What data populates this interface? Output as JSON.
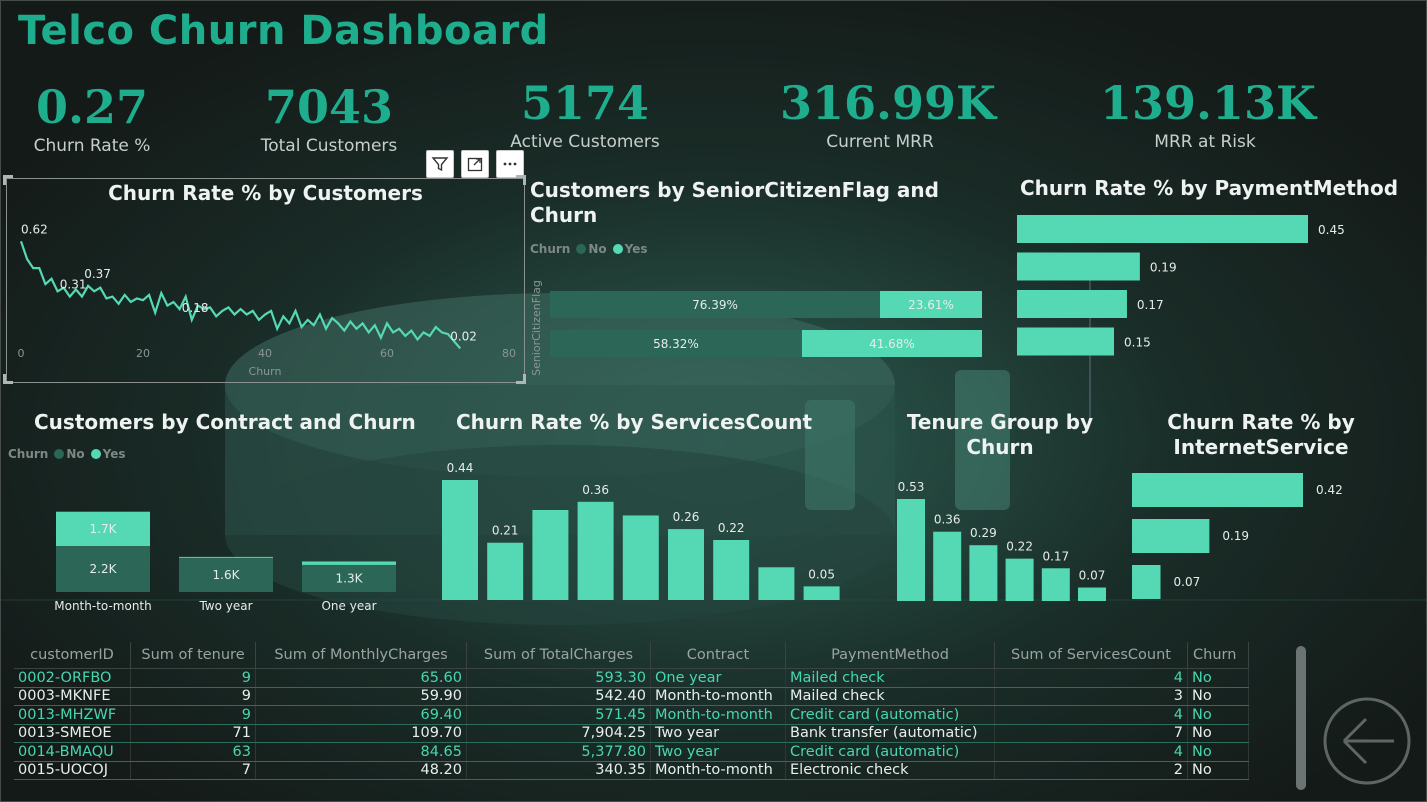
{
  "header": {
    "title": "Telco Churn Dashboard"
  },
  "kpis": [
    {
      "value": "0.27",
      "label": "Churn Rate %"
    },
    {
      "value": "7043",
      "label": "Total Customers"
    },
    {
      "value": "5174",
      "label": "Active Customers"
    },
    {
      "value": "316.99K",
      "label": "Current MRR"
    },
    {
      "value": "139.13K",
      "label": "MRR at Risk"
    }
  ],
  "visual_header": {
    "icons": [
      "filter-icon",
      "focus-mode-icon",
      "more-options-icon"
    ]
  },
  "colors": {
    "accent": "#1fae8d",
    "bar": "#55d9b4",
    "dark_bar": "#2b6657",
    "background": "#141a18"
  },
  "chart_data": [
    {
      "id": "churn_by_customers",
      "type": "line",
      "title": "Churn Rate % by Customers",
      "xlabel": "Churn",
      "xlim": [
        0,
        80
      ],
      "ylim": [
        0,
        0.7
      ],
      "x_ticks": [
        "0",
        "20",
        "40",
        "60",
        "80"
      ],
      "x": [
        0,
        1,
        2,
        3,
        4,
        5,
        6,
        7,
        8,
        9,
        10,
        11,
        12,
        13,
        14,
        15,
        16,
        17,
        18,
        19,
        20,
        21,
        22,
        23,
        24,
        25,
        26,
        27,
        28,
        29,
        30,
        31,
        32,
        33,
        34,
        35,
        36,
        37,
        38,
        39,
        40,
        41,
        42,
        43,
        44,
        45,
        46,
        47,
        48,
        49,
        50,
        51,
        52,
        53,
        54,
        55,
        56,
        57,
        58,
        59,
        60,
        61,
        62,
        63,
        64,
        65,
        66,
        67,
        68,
        69,
        70,
        71,
        72
      ],
      "y": [
        0.62,
        0.52,
        0.47,
        0.47,
        0.38,
        0.41,
        0.34,
        0.36,
        0.31,
        0.35,
        0.31,
        0.37,
        0.34,
        0.36,
        0.3,
        0.31,
        0.27,
        0.32,
        0.28,
        0.3,
        0.29,
        0.32,
        0.22,
        0.33,
        0.26,
        0.28,
        0.24,
        0.31,
        0.18,
        0.26,
        0.24,
        0.25,
        0.2,
        0.23,
        0.25,
        0.21,
        0.24,
        0.21,
        0.23,
        0.18,
        0.21,
        0.23,
        0.13,
        0.2,
        0.16,
        0.23,
        0.14,
        0.18,
        0.15,
        0.21,
        0.13,
        0.19,
        0.16,
        0.12,
        0.17,
        0.13,
        0.16,
        0.11,
        0.15,
        0.08,
        0.16,
        0.11,
        0.13,
        0.09,
        0.12,
        0.07,
        0.11,
        0.09,
        0.14,
        0.11,
        0.1,
        0.06,
        0.02
      ],
      "labels": [
        {
          "x": 0,
          "y": 0.62,
          "text": "0.62"
        },
        {
          "x": 12,
          "y": 0.37,
          "text": "0.37"
        },
        {
          "x": 8,
          "y": 0.31,
          "text": "0.31"
        },
        {
          "x": 28,
          "y": 0.18,
          "text": "0.18"
        },
        {
          "x": 72,
          "y": 0.02,
          "text": "0.02"
        }
      ]
    },
    {
      "id": "customers_by_senior",
      "type": "bar",
      "orientation": "horizontal-stacked-100",
      "title": "Customers by SeniorCitizenFlag and Churn",
      "ylabel": "SeniorCitizenFlag",
      "legend": {
        "title": "Churn",
        "items": [
          "No",
          "Yes"
        ]
      },
      "series": [
        {
          "name": "No",
          "values": [
            76.39,
            58.32
          ],
          "labels": [
            "76.39%",
            "58.32%"
          ]
        },
        {
          "name": "Yes",
          "values": [
            23.61,
            41.68
          ],
          "labels": [
            "23.61%",
            "41.68%"
          ]
        }
      ]
    },
    {
      "id": "churn_by_payment",
      "type": "bar",
      "orientation": "horizontal",
      "title": "Churn Rate % by PaymentMethod",
      "values": [
        0.45,
        0.19,
        0.17,
        0.15
      ],
      "labels": [
        "0.45",
        "0.19",
        "0.17",
        "0.15"
      ]
    },
    {
      "id": "customers_by_contract",
      "type": "bar",
      "orientation": "vertical-stacked",
      "title": "Customers by Contract and Churn",
      "legend": {
        "title": "Churn",
        "items": [
          "No",
          "Yes"
        ]
      },
      "categories": [
        "Month-to-month",
        "Two year",
        "One year"
      ],
      "series": [
        {
          "name": "No",
          "values": [
            2220,
            1647,
            1307
          ],
          "labels": [
            "2.2K",
            "1.6K",
            "1.3K"
          ]
        },
        {
          "name": "Yes",
          "values": [
            1655,
            48,
            166
          ],
          "labels": [
            "1.7K",
            "",
            ""
          ]
        }
      ]
    },
    {
      "id": "churn_by_servicescount",
      "type": "bar",
      "title": "Churn Rate % by ServicesCount",
      "values": [
        0.44,
        0.21,
        0.33,
        0.36,
        0.31,
        0.26,
        0.22,
        0.12,
        0.05
      ],
      "labels": [
        "0.44",
        "0.21",
        "",
        "0.36",
        "",
        "0.26",
        "0.22",
        "",
        "0.05"
      ]
    },
    {
      "id": "tenure_group_by_churn",
      "type": "bar",
      "title": "Tenure Group by Churn",
      "values": [
        0.53,
        0.36,
        0.29,
        0.22,
        0.17,
        0.07
      ],
      "labels": [
        "0.53",
        "0.36",
        "0.29",
        "0.22",
        "0.17",
        "0.07"
      ]
    },
    {
      "id": "churn_by_internetservice",
      "type": "bar",
      "orientation": "horizontal",
      "title": "Churn Rate % by InternetService",
      "values": [
        0.42,
        0.19,
        0.07
      ],
      "labels": [
        "0.42",
        "0.19",
        "0.07"
      ]
    }
  ],
  "table": {
    "columns": [
      "customerID",
      "Sum of tenure",
      "Sum of MonthlyCharges",
      "Sum of TotalCharges",
      "Contract",
      "PaymentMethod",
      "Sum of ServicesCount",
      "Churn"
    ],
    "rows": [
      [
        "0002-ORFBO",
        "9",
        "65.60",
        "593.30",
        "One year",
        "Mailed check",
        "4",
        "No"
      ],
      [
        "0003-MKNFE",
        "9",
        "59.90",
        "542.40",
        "Month-to-month",
        "Mailed check",
        "3",
        "No"
      ],
      [
        "0013-MHZWF",
        "9",
        "69.40",
        "571.45",
        "Month-to-month",
        "Credit card (automatic)",
        "4",
        "No"
      ],
      [
        "0013-SMEOE",
        "71",
        "109.70",
        "7,904.25",
        "Two year",
        "Bank transfer (automatic)",
        "7",
        "No"
      ],
      [
        "0014-BMAQU",
        "63",
        "84.65",
        "5,377.80",
        "Two year",
        "Credit card (automatic)",
        "4",
        "No"
      ],
      [
        "0015-UOCOJ",
        "7",
        "48.20",
        "340.35",
        "Month-to-month",
        "Electronic check",
        "2",
        "No"
      ]
    ]
  },
  "navigation": {
    "back_icon": "back-arrow-icon"
  }
}
